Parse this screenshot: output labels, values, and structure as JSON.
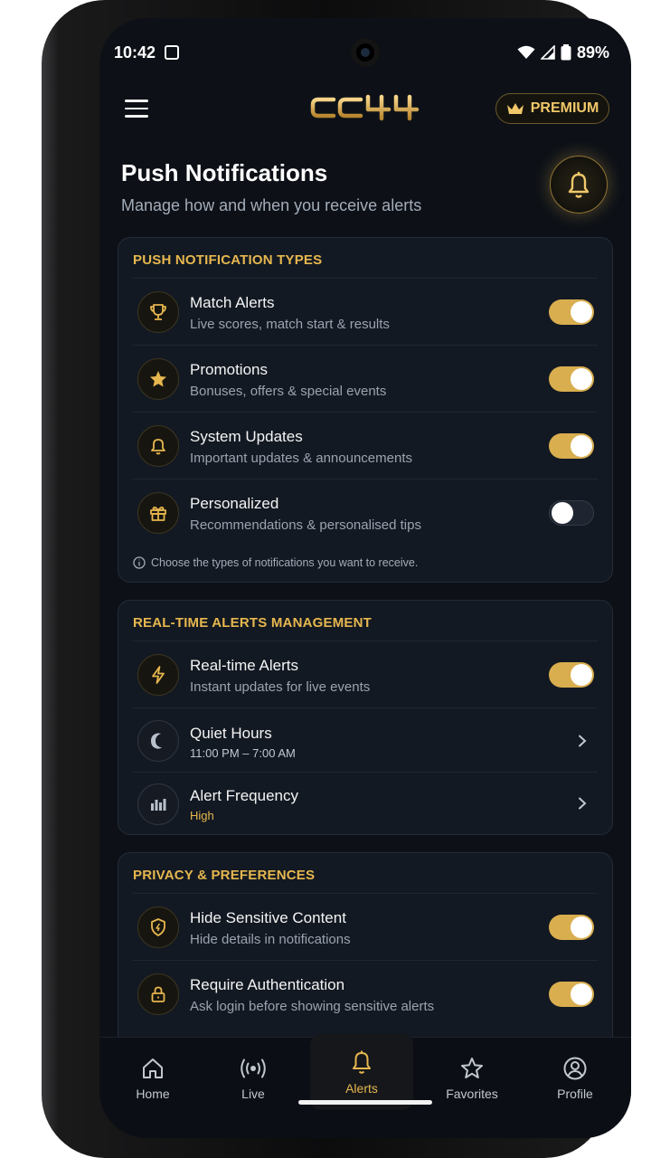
{
  "status": {
    "time": "10:42",
    "battery": "89%"
  },
  "app": {
    "logo_text": "CC44",
    "premium_label": "PREMIUM",
    "accent": "#E6B74F"
  },
  "header": {
    "title": "Push Notifications",
    "subtitle": "Manage how and when you receive alerts"
  },
  "types": {
    "title": "PUSH NOTIFICATION TYPES",
    "items": [
      {
        "icon": "trophy-icon",
        "title": "Match Alerts",
        "subtitle": "Live scores, match start & results",
        "enabled": true
      },
      {
        "icon": "star-icon",
        "title": "Promotions",
        "subtitle": "Bonuses, offers & special events",
        "enabled": true
      },
      {
        "icon": "bell-icon",
        "title": "System Updates",
        "subtitle": "Important updates & announcements",
        "enabled": true
      },
      {
        "icon": "gift-icon",
        "title": "Personalized",
        "subtitle": "Recommendations & personalised tips",
        "enabled": false
      }
    ],
    "note": "Choose the types of notifications you want to receive."
  },
  "realtime": {
    "title": "REAL-TIME ALERTS MANAGEMENT",
    "alerts": {
      "icon": "lightning-icon",
      "title": "Real-time Alerts",
      "subtitle": "Instant updates for live events",
      "enabled": true
    },
    "quiet": {
      "icon": "moon-icon",
      "title": "Quiet Hours",
      "subtitle": "11:00 PM – 7:00 AM"
    },
    "frequency": {
      "icon": "bar-chart-icon",
      "title": "Alert Frequency",
      "subtitle": "High"
    }
  },
  "privacy": {
    "title": "PRIVACY & PREFERENCES",
    "items": [
      {
        "icon": "shield-icon",
        "title": "Hide Sensitive Content",
        "subtitle": "Hide details in notifications",
        "enabled": true
      },
      {
        "icon": "lock-icon",
        "title": "Require Authentication",
        "subtitle": "Ask login before showing sensitive alerts",
        "enabled": true
      }
    ]
  },
  "nav": [
    {
      "label": "Home",
      "icon": "home-icon",
      "active": false
    },
    {
      "label": "Live",
      "icon": "broadcast-icon",
      "active": false
    },
    {
      "label": "Alerts",
      "icon": "bell-icon",
      "active": true
    },
    {
      "label": "Favorites",
      "icon": "star-outline-icon",
      "active": false
    },
    {
      "label": "Profile",
      "icon": "user-icon",
      "active": false
    }
  ]
}
